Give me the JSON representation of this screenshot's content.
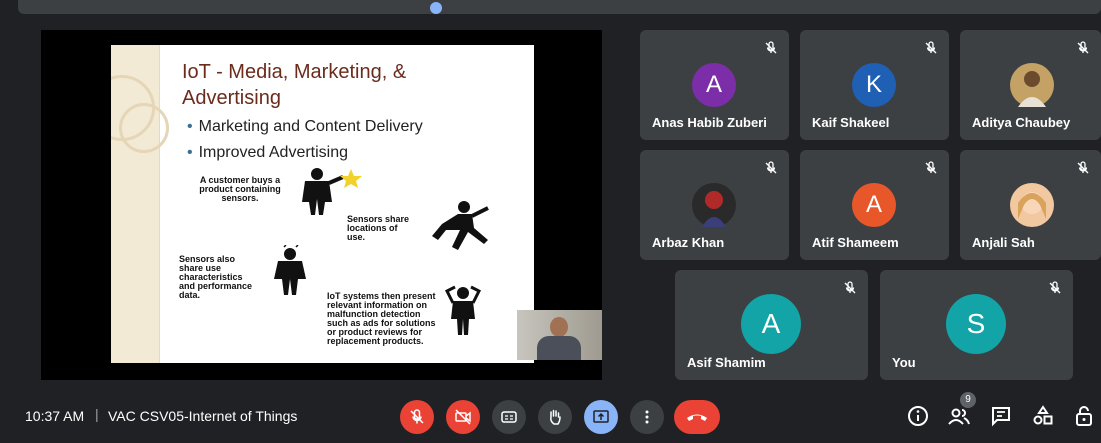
{
  "slide": {
    "title": "IoT - Media, Marketing, & Advertising",
    "bullets": [
      "Marketing and Content Delivery",
      "Improved Advertising"
    ],
    "texts": {
      "customer": [
        "A customer buys a",
        "product containing",
        "sensors."
      ],
      "sensors_share": [
        "Sensors share",
        "locations of",
        "use."
      ],
      "sensors_also": [
        "Sensors also",
        "share use",
        "characteristics",
        "and performance",
        "data."
      ],
      "iot_systems_1": [
        "IoT systems then present",
        "relevant information on"
      ],
      "iot_systems_red": "malfunction detection",
      "iot_systems_2": [
        "such as ads for solutions",
        "or product reviews for",
        "replacement products."
      ]
    }
  },
  "participants": [
    {
      "name": "Anas Habib Zuberi",
      "initial": "A",
      "color": "#7b2ea8"
    },
    {
      "name": "Kaif Shakeel",
      "initial": "K",
      "color": "#1f5fb4"
    },
    {
      "name": "Aditya Chaubey",
      "initial": "",
      "color": "#c4a266"
    },
    {
      "name": "Arbaz Khan",
      "initial": "",
      "color": "#2a2a2a"
    },
    {
      "name": "Atif Shameem",
      "initial": "A",
      "color": "#e8572a"
    },
    {
      "name": "Anjali Sah",
      "initial": "",
      "color": "#f2c8a0"
    },
    {
      "name": "Asif Shamim",
      "initial": "A",
      "color": "#12a4a6"
    },
    {
      "name": "You",
      "initial": "S",
      "color": "#12a4a6"
    }
  ],
  "meeting": {
    "time": "10:37 AM",
    "separator": "|",
    "name": "VAC CSV05-Internet of Things",
    "people_count": "9"
  },
  "colors": {
    "end_call": "#ea4335",
    "present_active": "#8ab4f8"
  }
}
